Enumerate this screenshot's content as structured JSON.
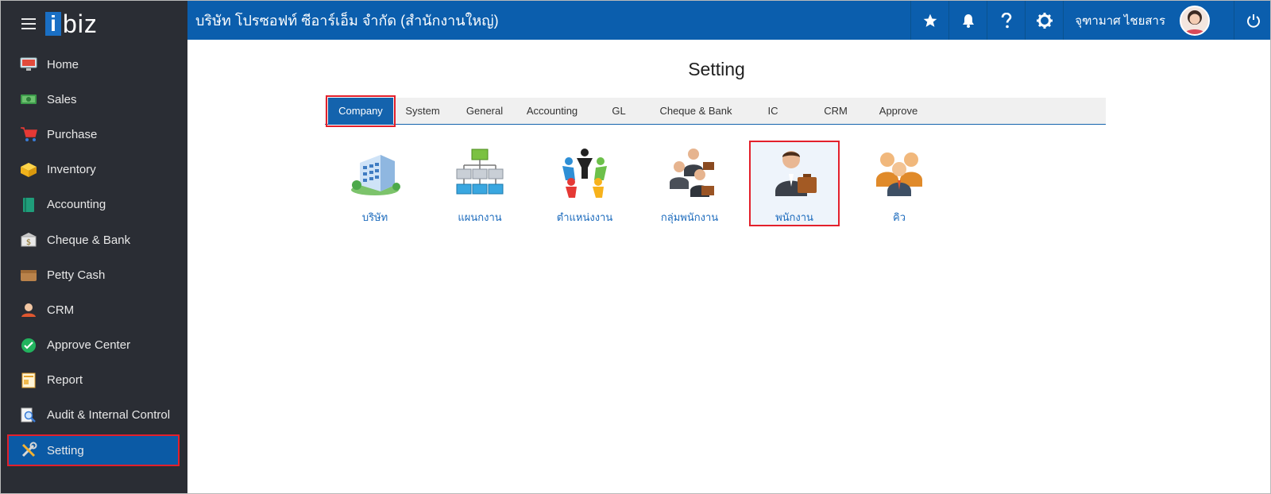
{
  "brand": {
    "logo_i": "i",
    "logo_rest": "biz"
  },
  "sidebar": {
    "items": [
      {
        "label": "Home",
        "icon": "monitor-icon"
      },
      {
        "label": "Sales",
        "icon": "money-icon"
      },
      {
        "label": "Purchase",
        "icon": "cart-icon"
      },
      {
        "label": "Inventory",
        "icon": "box-icon"
      },
      {
        "label": "Accounting",
        "icon": "book-icon"
      },
      {
        "label": "Cheque & Bank",
        "icon": "bank-icon"
      },
      {
        "label": "Petty Cash",
        "icon": "wallet-icon"
      },
      {
        "label": "CRM",
        "icon": "contact-icon"
      },
      {
        "label": "Approve Center",
        "icon": "check-circle-icon"
      },
      {
        "label": "Report",
        "icon": "report-icon"
      },
      {
        "label": "Audit & Internal Control",
        "icon": "magnifier-doc-icon"
      },
      {
        "label": "Setting",
        "icon": "tools-icon",
        "active": true
      }
    ]
  },
  "header": {
    "company_name": "บริษัท โปรซอฟท์ ซีอาร์เอ็ม จำกัด (สำนักงานใหญ่)",
    "user_name": "จุฑามาศ ไชยสาร",
    "accent": "#0b5ead"
  },
  "main": {
    "title": "Setting",
    "tabs": [
      {
        "label": "Company",
        "active": true
      },
      {
        "label": "System"
      },
      {
        "label": "General"
      },
      {
        "label": "Accounting"
      },
      {
        "label": "GL"
      },
      {
        "label": "Cheque & Bank"
      },
      {
        "label": "IC"
      },
      {
        "label": "CRM"
      },
      {
        "label": "Approve"
      }
    ],
    "tiles": [
      {
        "label": "บริษัท",
        "icon": "building-icon"
      },
      {
        "label": "แผนกงาน",
        "icon": "org-chart-icon"
      },
      {
        "label": "ตำแหน่งงาน",
        "icon": "people-circle-icon"
      },
      {
        "label": "กลุ่มพนักงาน",
        "icon": "employee-group-icon"
      },
      {
        "label": "พนักงาน",
        "icon": "employee-icon",
        "selected": true
      },
      {
        "label": "คิว",
        "icon": "queue-people-icon"
      }
    ]
  }
}
